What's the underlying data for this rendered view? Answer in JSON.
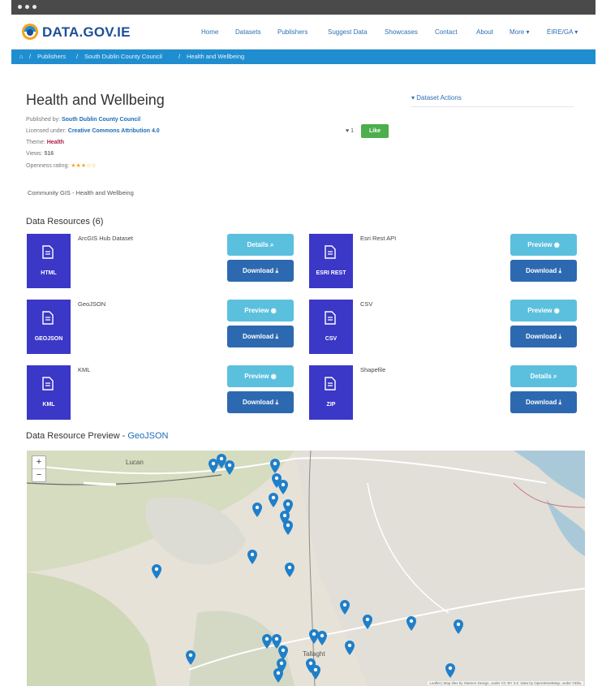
{
  "site": {
    "logo_text": "DATA.GOV.IE"
  },
  "nav": [
    "Home",
    "Datasets",
    "Publishers",
    "Suggest Data",
    "Showcases",
    "Contact",
    "About",
    "More ▾",
    "ÉIRE/GA ▾"
  ],
  "breadcrumb": {
    "home_icon": "⌂",
    "items": [
      "Publishers",
      "South Dublin County Council",
      "Health and Wellbeing"
    ],
    "separator": "/"
  },
  "dataset": {
    "title": "Health and Wellbeing",
    "published_by_label": "Published by:",
    "published_by": "South Dublin County Council",
    "license_label": "Licensed under:",
    "license": "Creative Commons Attribution 4.0",
    "theme_label": "Theme:",
    "theme": "Health",
    "views_label": "Views:",
    "views": "516",
    "openness_label": "Openness rating:",
    "openness_stars": "★★★☆☆",
    "description": "Community GIS - Health and Wellbeing"
  },
  "actions": {
    "label": "▾ Dataset Actions"
  },
  "likes": {
    "count": "1",
    "button": "Like"
  },
  "resources": {
    "heading": "Data Resources (6)",
    "items": [
      {
        "name": "ArcGIS Hub Dataset",
        "format": "HTML",
        "primary": "Details ⌕",
        "secondary": "Download ⤓"
      },
      {
        "name": "Esri Rest API",
        "format": "ESRI REST",
        "primary": "Preview ◉",
        "secondary": "Download ⤓"
      },
      {
        "name": "GeoJSON",
        "format": "GEOJSON",
        "primary": "Preview ◉",
        "secondary": "Download ⤓"
      },
      {
        "name": "CSV",
        "format": "CSV",
        "primary": "Preview ◉",
        "secondary": "Download ⤓"
      },
      {
        "name": "KML",
        "format": "KML",
        "primary": "Preview ◉",
        "secondary": "Download ⤓"
      },
      {
        "name": "Shapefile",
        "format": "ZIP",
        "primary": "Details ⌕",
        "secondary": "Download ⤓"
      }
    ]
  },
  "preview": {
    "heading_prefix": "Data Resource Preview - ",
    "heading_link": "GeoJSON"
  },
  "map": {
    "zoom_in": "+",
    "zoom_out": "−",
    "town_labels": [
      "Lucan",
      "Tallaght"
    ],
    "attribution": "Leaflet | Map tiles by Stamen Design, under CC BY 3.0. Data by OpenStreetMap, under ODbL",
    "pin_color": "#1f7fc9"
  },
  "colors": {
    "brand": "#1d4f9a",
    "breadcrumb_bar": "#1f8ed0",
    "resource_icon": "#3b37c7",
    "button_light": "#5bc0de",
    "button_dark": "#2d69b0",
    "like": "#4cae4c"
  }
}
